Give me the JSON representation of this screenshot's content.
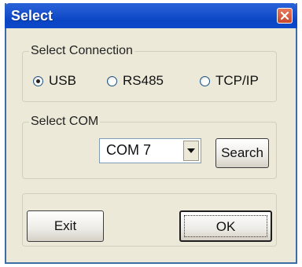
{
  "window": {
    "title": "Select"
  },
  "connection_group": {
    "legend": "Select Connection",
    "options": [
      {
        "label": "USB",
        "checked": true
      },
      {
        "label": "RS485",
        "checked": false
      },
      {
        "label": "TCP/IP",
        "checked": false
      }
    ]
  },
  "com_group": {
    "legend": "Select COM",
    "selected_port": "COM 7",
    "search_label": "Search"
  },
  "buttons": {
    "exit_label": "Exit",
    "ok_label": "OK"
  },
  "colors": {
    "titlebar": "#0a45c4",
    "dialog_bg": "#ece9d8",
    "close_button": "#c8472c"
  },
  "icons": {
    "close": "close-icon",
    "dropdown": "chevron-down-icon"
  }
}
